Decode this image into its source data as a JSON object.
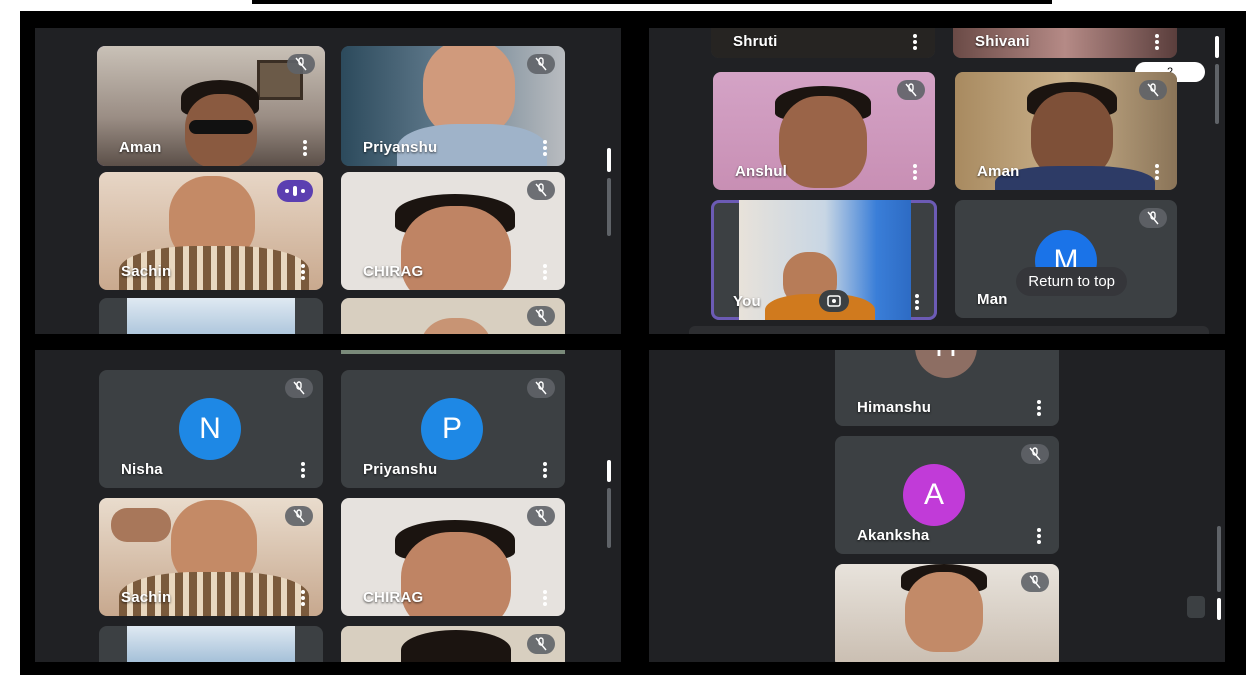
{
  "panel1": {
    "tiles": [
      {
        "name": "Aman"
      },
      {
        "name": "Priyanshu"
      },
      {
        "name": "Sachin"
      },
      {
        "name": "CHIRAG"
      }
    ]
  },
  "panel2": {
    "tiles": [
      {
        "name": "Shruti"
      },
      {
        "name": "Shivani"
      },
      {
        "name": "Anshul"
      },
      {
        "name": "Aman"
      },
      {
        "name": "You"
      },
      {
        "name": "Man",
        "initial": "M"
      }
    ],
    "page_badge": "2",
    "return_to_top": "Return to top"
  },
  "panel3": {
    "tiles": [
      {
        "name": "Nisha",
        "initial": "N"
      },
      {
        "name": "Priyanshu",
        "initial": "P"
      },
      {
        "name": "Sachin"
      },
      {
        "name": "CHIRAG"
      }
    ]
  },
  "panel4": {
    "tiles": [
      {
        "name": "Himanshu",
        "initial": "H"
      },
      {
        "name": "Akanksha",
        "initial": "A"
      }
    ]
  },
  "colors": {
    "background": "#202124",
    "tile": "#3c4043",
    "avatar_blue": "#1a73e8",
    "avatar_blue_alt": "#1e88e5",
    "avatar_purple": "#c13bd8",
    "avatar_brown": "#8d6e63",
    "highlight": "#6c5bb5"
  },
  "icons": {
    "mute": "mic-off-icon",
    "menu": "more-vert-icon",
    "speaking": "speaking-indicator-icon",
    "camera": "camera-switch-icon"
  }
}
